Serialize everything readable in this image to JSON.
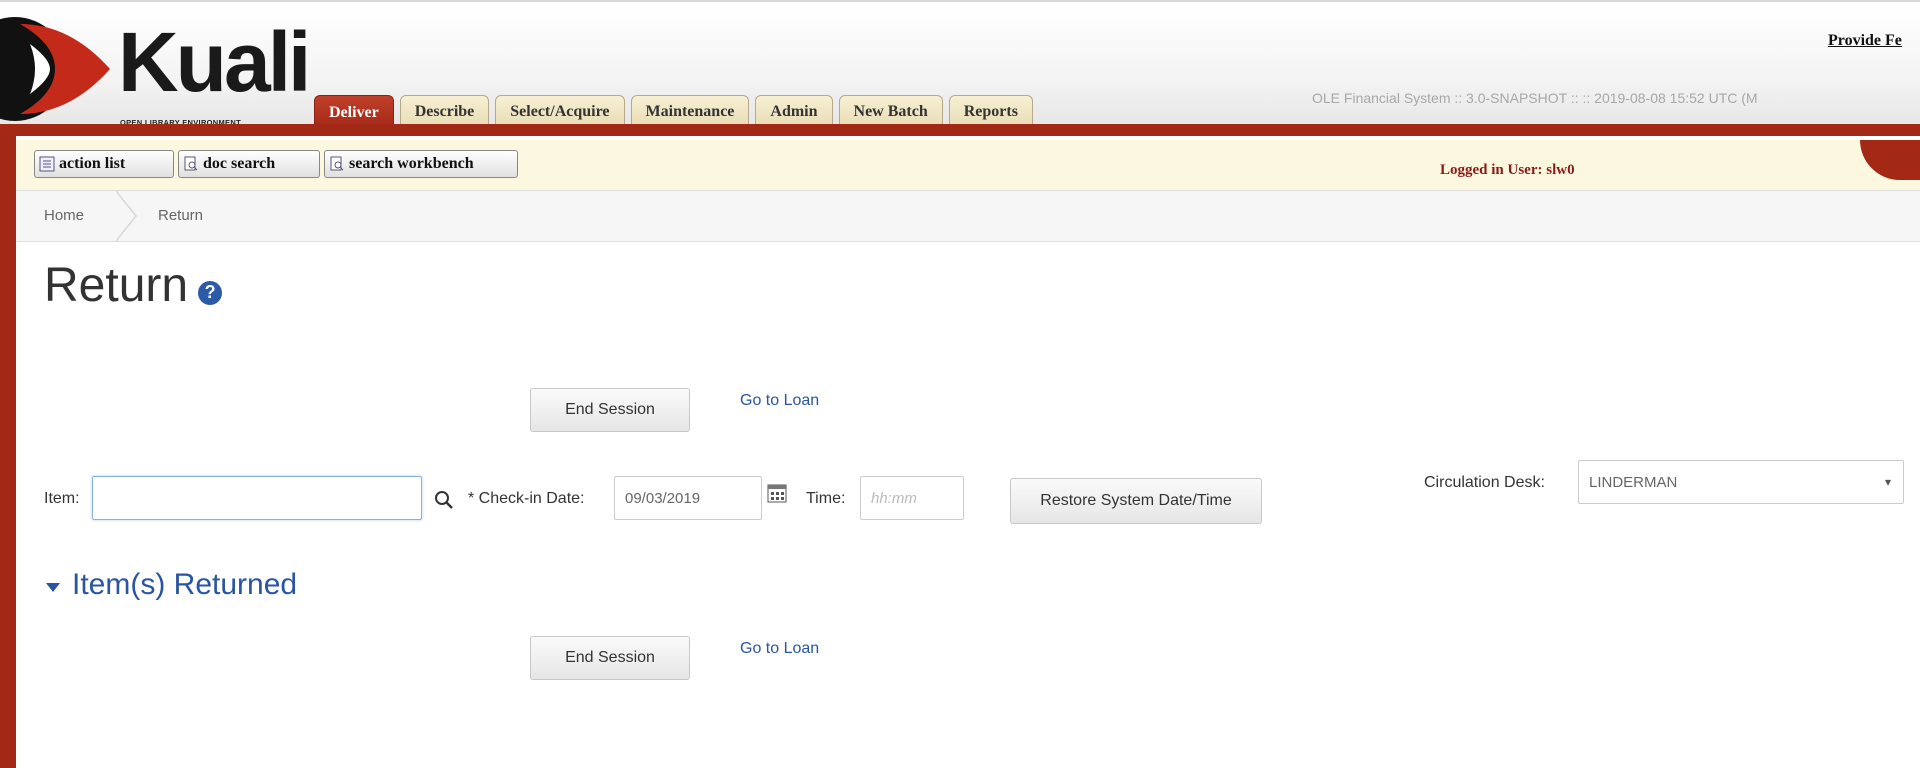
{
  "header": {
    "brand": "Kuali",
    "brand_sub": "OPEN LIBRARY ENVIRONMENT",
    "feedback_link": "Provide Fe",
    "system_info": "OLE Financial System :: 3.0-SNAPSHOT :: :: 2019-08-08 15:52 UTC (M",
    "tabs": [
      "Deliver",
      "Describe",
      "Select/Acquire",
      "Maintenance",
      "Admin",
      "New Batch",
      "Reports"
    ],
    "active_tab": "Deliver"
  },
  "toolbar": {
    "action_list": "action list",
    "doc_search": "doc search",
    "search_workbench": "search workbench",
    "logged_in": "Logged in User: slw0"
  },
  "breadcrumb": {
    "home": "Home",
    "current": "Return"
  },
  "page": {
    "title": "Return",
    "end_session": "End Session",
    "go_to_loan": "Go to Loan",
    "item_label": "Item:",
    "item_value": "",
    "checkin_label": "* Check-in Date:",
    "checkin_value": "09/03/2019",
    "time_label": "Time:",
    "time_placeholder": "hh:mm",
    "restore_button": "Restore System Date/Time",
    "desk_label": "Circulation Desk:",
    "desk_value": "LINDERMAN",
    "section_title": "Item(s) Returned"
  },
  "colors": {
    "brand_red": "#a32816",
    "link_blue": "#2a55a0",
    "toolbar_bg": "#fbf8df",
    "logged_in_text": "#8b1a1a"
  },
  "icons": [
    "kuali-logo-icon",
    "action-list-icon",
    "doc-search-icon",
    "search-workbench-icon",
    "help-icon",
    "search-icon",
    "calendar-icon",
    "dropdown-arrow-icon",
    "collapse-triangle-icon"
  ]
}
